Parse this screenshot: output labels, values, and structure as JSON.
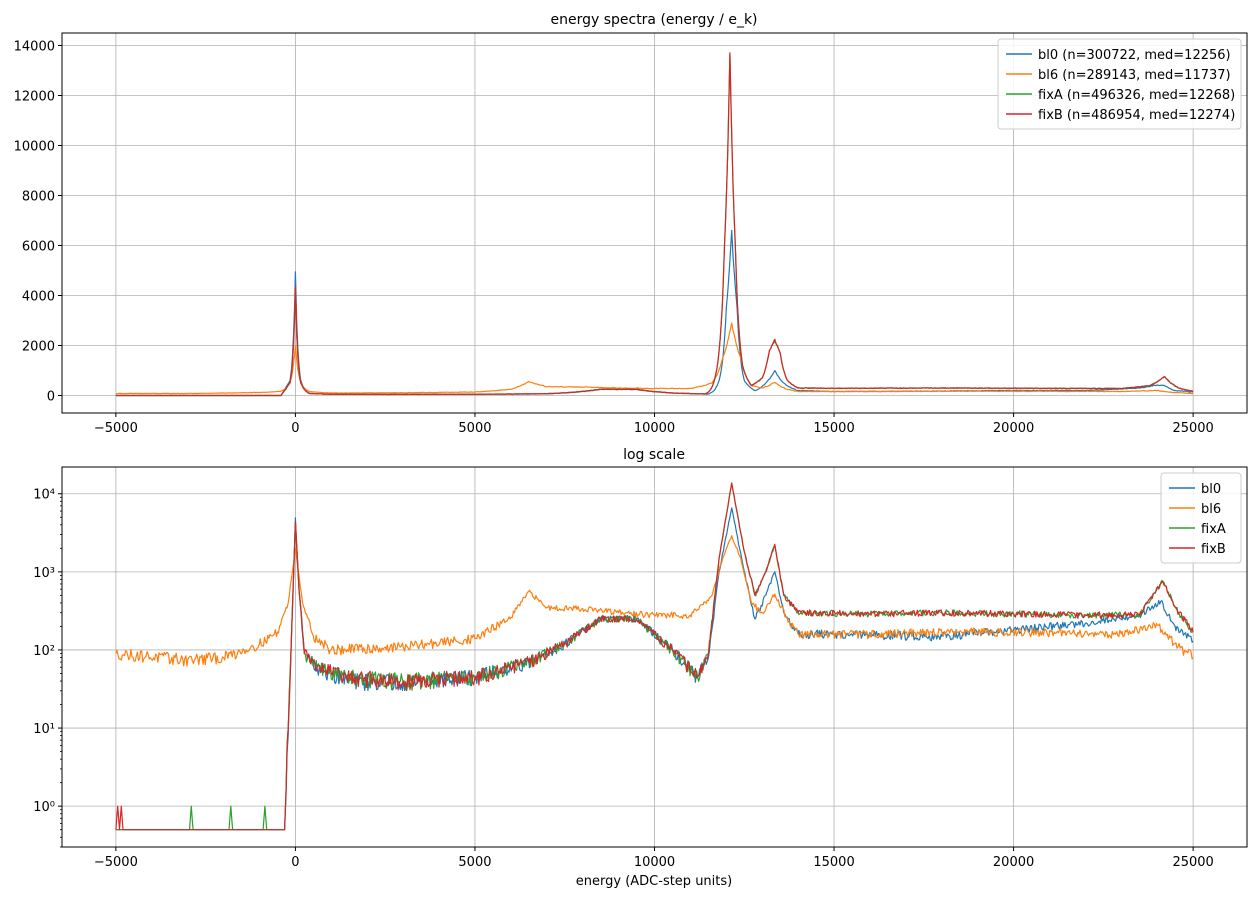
{
  "figure": {
    "xlabel": "energy (ADC-step units)"
  },
  "colors": {
    "bl0": "#1f77b4",
    "bl6": "#ff7f0e",
    "fixA": "#2ca02c",
    "fixB": "#d62728",
    "grid": "#b0b0b0"
  },
  "chart_data": [
    {
      "type": "line",
      "title": "energy spectra (energy / e_k)",
      "xlabel": "",
      "ylabel": "",
      "xlim": [
        -6500,
        26500
      ],
      "ylim": [
        -700,
        14500
      ],
      "yscale": "linear",
      "grid": true,
      "legend_position": "top-right",
      "xticks": [
        -5000,
        0,
        5000,
        10000,
        15000,
        20000,
        25000
      ],
      "xtick_labels": [
        "−5000",
        "0",
        "5000",
        "10000",
        "15000",
        "20000",
        "25000"
      ],
      "yticks": [
        0,
        2000,
        4000,
        6000,
        8000,
        10000,
        12000,
        14000
      ],
      "ytick_labels": [
        "0",
        "2000",
        "4000",
        "6000",
        "8000",
        "10000",
        "12000",
        "14000"
      ],
      "series": [
        {
          "name": "bl0",
          "legend": "bl0 (n=300722, med=12256)",
          "color": "#1f77b4",
          "x": [
            -5000,
            -1000,
            -400,
            -150,
            0,
            150,
            400,
            1000,
            3000,
            5000,
            7000,
            8500,
            9500,
            10500,
            11500,
            11800,
            12000,
            12150,
            12300,
            12500,
            12800,
            13100,
            13350,
            13600,
            14000,
            15000,
            17000,
            20000,
            22000,
            23500,
            24000,
            24200,
            24500,
            25000
          ],
          "values": [
            0,
            0,
            0,
            600,
            4950,
            600,
            80,
            50,
            45,
            50,
            70,
            250,
            240,
            100,
            60,
            600,
            3500,
            6600,
            3500,
            600,
            200,
            500,
            1000,
            500,
            200,
            160,
            170,
            200,
            200,
            300,
            420,
            400,
            200,
            140
          ]
        },
        {
          "name": "bl6",
          "legend": "bl6 (n=289143, med=11737)",
          "color": "#ff7f0e",
          "x": [
            -5000,
            -3000,
            -1000,
            -400,
            -150,
            0,
            150,
            400,
            1000,
            3000,
            5000,
            6000,
            6500,
            7000,
            8000,
            9000,
            10000,
            11000,
            11600,
            11900,
            12150,
            12400,
            12700,
            13000,
            13350,
            13700,
            14000,
            16000,
            18000,
            20000,
            23000,
            24000,
            24500,
            25000
          ],
          "values": [
            80,
            80,
            120,
            170,
            500,
            2000,
            500,
            150,
            100,
            110,
            140,
            250,
            560,
            350,
            340,
            300,
            280,
            280,
            500,
            1500,
            2900,
            1500,
            400,
            300,
            520,
            250,
            160,
            160,
            170,
            170,
            160,
            200,
            120,
            80
          ]
        },
        {
          "name": "fixA",
          "legend": "fixA (n=496326, med=12268)",
          "color": "#2ca02c",
          "x": [
            -5000,
            -1000,
            -400,
            -150,
            0,
            150,
            400,
            1000,
            3000,
            5000,
            7000,
            8500,
            9500,
            10500,
            11400,
            11700,
            11950,
            12100,
            12250,
            12450,
            12700,
            13000,
            13200,
            13350,
            13500,
            13700,
            14000,
            15000,
            18000,
            20000,
            23000,
            23800,
            24200,
            24600,
            25000
          ],
          "values": [
            0,
            0,
            0,
            500,
            4300,
            500,
            80,
            50,
            45,
            50,
            70,
            250,
            250,
            100,
            60,
            800,
            6000,
            13700,
            6000,
            1200,
            400,
            700,
            1800,
            2200,
            1700,
            600,
            300,
            290,
            300,
            290,
            280,
            400,
            760,
            300,
            170
          ]
        },
        {
          "name": "fixB",
          "legend": "fixB (n=486954, med=12274)",
          "color": "#d62728",
          "x": [
            -5000,
            -1000,
            -400,
            -150,
            0,
            150,
            400,
            1000,
            3000,
            5000,
            7000,
            8500,
            9500,
            10500,
            11400,
            11700,
            11950,
            12100,
            12250,
            12450,
            12700,
            13000,
            13200,
            13350,
            13500,
            13700,
            14000,
            15000,
            18000,
            20000,
            23000,
            23800,
            24200,
            24600,
            25000
          ],
          "values": [
            0,
            0,
            0,
            500,
            4350,
            500,
            80,
            50,
            45,
            50,
            70,
            250,
            250,
            100,
            60,
            800,
            6000,
            13700,
            6000,
            1200,
            400,
            700,
            1800,
            2250,
            1700,
            600,
            300,
            290,
            300,
            290,
            280,
            400,
            760,
            300,
            170
          ]
        }
      ]
    },
    {
      "type": "line",
      "title": "log scale",
      "xlabel": "energy (ADC-step units)",
      "ylabel": "",
      "xlim": [
        -6500,
        26500
      ],
      "ylim": [
        0.3,
        22000
      ],
      "yscale": "log",
      "grid": true,
      "legend_position": "top-right",
      "xticks": [
        -5000,
        0,
        5000,
        10000,
        15000,
        20000,
        25000
      ],
      "xtick_labels": [
        "−5000",
        "0",
        "5000",
        "10000",
        "15000",
        "20000",
        "25000"
      ],
      "yticks": [
        1,
        10,
        100,
        1000,
        10000
      ],
      "ytick_labels": [
        "10⁰",
        "10¹",
        "10²",
        "10³",
        "10⁴"
      ],
      "series": [
        {
          "name": "bl0",
          "legend": "bl0",
          "color": "#1f77b4",
          "x": [
            -5000,
            -400,
            -300,
            -200,
            -100,
            0,
            100,
            250,
            600,
            1500,
            3000,
            5000,
            6500,
            7500,
            8500,
            9500,
            10500,
            11200,
            11500,
            11800,
            12150,
            12500,
            12800,
            13100,
            13350,
            13600,
            14000,
            15000,
            18000,
            20000,
            22000,
            23500,
            24100,
            24500,
            25000
          ],
          "values": [
            0.5,
            0.5,
            0.5,
            8,
            200,
            4900,
            600,
            90,
            60,
            40,
            40,
            45,
            70,
            120,
            250,
            250,
            100,
            45,
            80,
            1000,
            6600,
            1000,
            250,
            500,
            1000,
            300,
            160,
            160,
            150,
            180,
            220,
            280,
            420,
            200,
            130
          ]
        },
        {
          "name": "bl6",
          "legend": "bl6",
          "color": "#ff7f0e",
          "x": [
            -5000,
            -3000,
            -2000,
            -1000,
            -500,
            -200,
            0,
            200,
            500,
            1000,
            3000,
            5000,
            6000,
            6500,
            7000,
            8000,
            9000,
            10000,
            11000,
            11600,
            11900,
            12150,
            12400,
            12700,
            13000,
            13350,
            13700,
            14000,
            16000,
            18000,
            20000,
            23000,
            24000,
            24500,
            25000
          ],
          "values": [
            90,
            75,
            80,
            120,
            170,
            400,
            2000,
            400,
            150,
            100,
            110,
            140,
            260,
            560,
            350,
            340,
            300,
            280,
            280,
            500,
            1500,
            2900,
            1500,
            400,
            300,
            520,
            250,
            160,
            160,
            170,
            170,
            160,
            210,
            120,
            80
          ]
        },
        {
          "name": "fixA",
          "legend": "fixA",
          "color": "#2ca02c",
          "x": [
            -5000,
            -2950,
            -2900,
            -2850,
            -1850,
            -1800,
            -1750,
            -900,
            -850,
            -800,
            -500,
            -300,
            -200,
            -100,
            0,
            100,
            250,
            600,
            1500,
            3000,
            5000,
            6500,
            7500,
            8500,
            9500,
            10500,
            11200,
            11500,
            11800,
            12150,
            12500,
            12800,
            13100,
            13350,
            13600,
            14000,
            16000,
            18000,
            20000,
            22000,
            23500,
            24150,
            24600,
            25000
          ],
          "values": [
            0.5,
            0.5,
            1,
            0.5,
            0.5,
            1,
            0.5,
            0.5,
            1,
            0.5,
            0.5,
            0.5,
            10,
            200,
            4300,
            600,
            90,
            60,
            45,
            40,
            45,
            70,
            120,
            250,
            250,
            100,
            45,
            90,
            1500,
            13700,
            1800,
            500,
            1000,
            2200,
            500,
            300,
            290,
            300,
            290,
            280,
            280,
            760,
            300,
            170
          ]
        },
        {
          "name": "fixB",
          "legend": "fixB",
          "color": "#d62728",
          "x": [
            -5000,
            -4950,
            -4900,
            -4850,
            -4800,
            -4750,
            -500,
            -300,
            -200,
            -100,
            0,
            100,
            250,
            600,
            1500,
            3000,
            5000,
            6500,
            7500,
            8500,
            9500,
            10500,
            11200,
            11500,
            11800,
            12150,
            12500,
            12800,
            13100,
            13350,
            13600,
            14000,
            16000,
            18000,
            20000,
            22000,
            23500,
            24150,
            24600,
            25000
          ],
          "values": [
            0.5,
            1,
            0.5,
            1,
            0.5,
            0.5,
            0.5,
            0.5,
            10,
            200,
            4350,
            600,
            90,
            60,
            45,
            40,
            45,
            70,
            120,
            250,
            250,
            100,
            45,
            90,
            1500,
            13700,
            1800,
            500,
            1000,
            2250,
            500,
            300,
            290,
            300,
            290,
            280,
            280,
            760,
            300,
            170
          ]
        }
      ]
    }
  ]
}
